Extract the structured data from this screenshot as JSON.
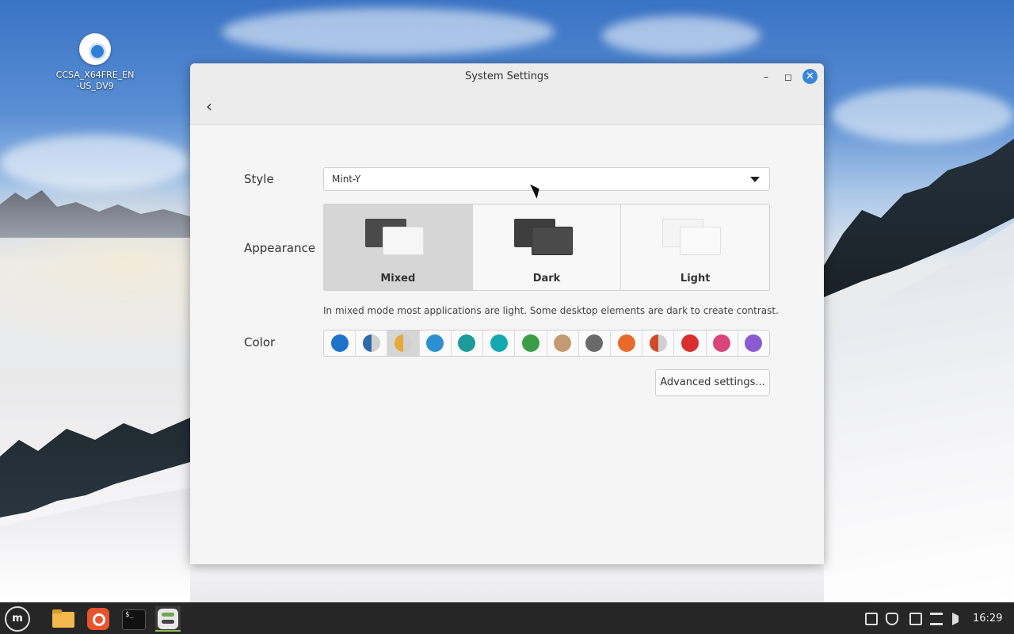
{
  "desktop": {
    "icon_label": "CCSA_X64FRE_EN-US_DV9"
  },
  "window": {
    "title": "System Settings",
    "back_label": "‹",
    "minimize_label": "–",
    "maximize_label": "◻",
    "close_label": "✕"
  },
  "style": {
    "label": "Style",
    "selected_value": "Mint-Y"
  },
  "appearance": {
    "label": "Appearance",
    "options": [
      {
        "name": "Mixed",
        "selected": true
      },
      {
        "name": "Dark",
        "selected": false
      },
      {
        "name": "Light",
        "selected": false
      }
    ],
    "hint": "In mixed mode most applications are light. Some desktop elements are dark to create contrast."
  },
  "color": {
    "label": "Color",
    "selected_index": 2,
    "swatches": [
      {
        "name": "blue",
        "color": "#1f72c9"
      },
      {
        "name": "aqua-split",
        "color": "#2d6aa8"
      },
      {
        "name": "sand-split",
        "color": "#e7a93a"
      },
      {
        "name": "sky",
        "color": "#2c8fd0"
      },
      {
        "name": "teal",
        "color": "#1d9a9a"
      },
      {
        "name": "cyan",
        "color": "#14a8b0"
      },
      {
        "name": "green",
        "color": "#3a9d48"
      },
      {
        "name": "sand",
        "color": "#c49a72"
      },
      {
        "name": "grey",
        "color": "#6a6a6a"
      },
      {
        "name": "orange",
        "color": "#e86a2a"
      },
      {
        "name": "red-split",
        "color": "#d24a2a"
      },
      {
        "name": "red",
        "color": "#d9302f"
      },
      {
        "name": "pink",
        "color": "#d9467a"
      },
      {
        "name": "purple",
        "color": "#8a5bd1"
      }
    ]
  },
  "advanced_button": "Advanced settings...",
  "taskbar": {
    "clock": "16:29",
    "mint_label": "m"
  }
}
